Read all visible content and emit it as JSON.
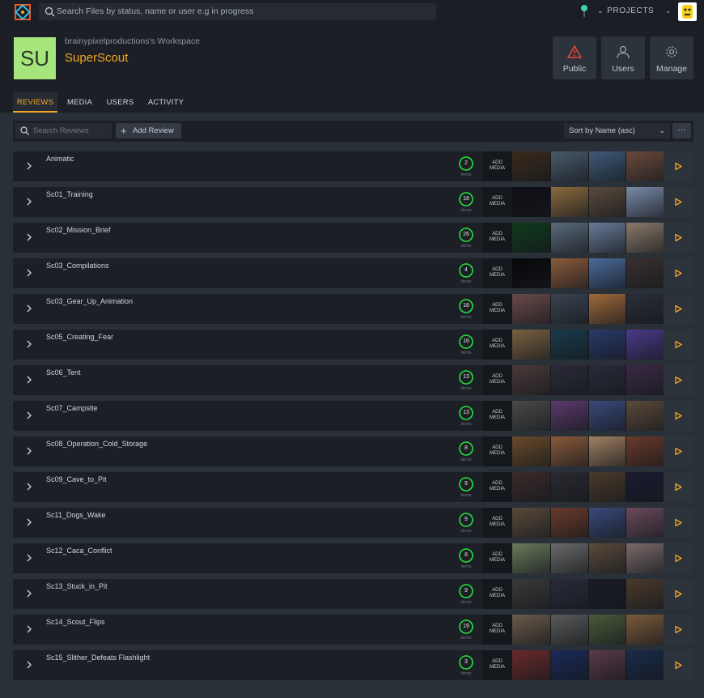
{
  "topbar": {
    "search_placeholder": "Search Files by status, name or user e.g in progress",
    "projects_label": "PROJECTS"
  },
  "workspace": {
    "initials": "SU",
    "workspace_name": "brainypixelproductions's Workspace",
    "project_name": "SuperScout",
    "actions": [
      {
        "label": "Public",
        "icon": "warning-icon"
      },
      {
        "label": "Users",
        "icon": "user-icon"
      },
      {
        "label": "Manage",
        "icon": "gear-icon"
      }
    ]
  },
  "tabs": [
    {
      "label": "REVIEWS",
      "active": true
    },
    {
      "label": "MEDIA",
      "active": false
    },
    {
      "label": "USERS",
      "active": false
    },
    {
      "label": "ACTIVITY",
      "active": false
    }
  ],
  "toolbar": {
    "search_placeholder": "Search Reviews",
    "add_review_label": "Add Review",
    "sort_label": "Sort by Name (asc)",
    "more_label": "···"
  },
  "row_labels": {
    "items_label": "items",
    "add_media_line1": "ADD",
    "add_media_line2": "MEDIA"
  },
  "colors": {
    "accent": "#f5a623",
    "ring_green": "#22e03a",
    "workspace_badge": "#a6e57c"
  },
  "reviews": [
    {
      "name": "Animatic",
      "count": "2",
      "thumbs": [
        "#3a2a1c",
        "#4a5a6a",
        "#3e5a78",
        "#6a4a3a"
      ]
    },
    {
      "name": "Sc01_Training",
      "count": "18",
      "thumbs": [
        "#0e0e14",
        "#8a6a3c",
        "#5a4a3c",
        "#7a8aa8"
      ]
    },
    {
      "name": "Sc02_Mission_Brief",
      "count": "26",
      "thumbs": [
        "#0e3a1c",
        "#5a6a7a",
        "#6a7a9a",
        "#8a7a6a"
      ]
    },
    {
      "name": "Sc03_Compilations",
      "count": "4",
      "thumbs": [
        "#08080a",
        "#8a5a3a",
        "#4a6a9a",
        "#3a3030"
      ]
    },
    {
      "name": "Sc03_Gear_Up_Animation",
      "count": "18",
      "thumbs": [
        "#6a4a4a",
        "#3a4450",
        "#a06a3a",
        "#2a2e36"
      ]
    },
    {
      "name": "Sc05_Creating_Fear",
      "count": "16",
      "thumbs": [
        "#7a6040",
        "#1a3a4a",
        "#2a3a6a",
        "#4a3a8a"
      ]
    },
    {
      "name": "Sc06_Tent",
      "count": "13",
      "thumbs": [
        "#4a3a3a",
        "#2a2a38",
        "#2a2a3a",
        "#3a2a44"
      ]
    },
    {
      "name": "Sc07_Campsite",
      "count": "13",
      "thumbs": [
        "#4a4a4a",
        "#5a3a6a",
        "#3a4a7a",
        "#5a4a3a"
      ]
    },
    {
      "name": "Sc08_Operation_Cold_Storage",
      "count": "8",
      "thumbs": [
        "#6a4a2a",
        "#8a5a3a",
        "#a08060",
        "#6a3a2a"
      ]
    },
    {
      "name": "Sc09_Cave_to_Pit",
      "count": "9",
      "thumbs": [
        "#3a2a2a",
        "#2a2a30",
        "#4a3a2a",
        "#1a1a30"
      ]
    },
    {
      "name": "Sc11_Dogs_Wake",
      "count": "9",
      "thumbs": [
        "#5a4a3a",
        "#6a3a2a",
        "#3a4a7a",
        "#6a4a5a"
      ]
    },
    {
      "name": "Sc12_Caca_Conflict",
      "count": "8",
      "thumbs": [
        "#6a7a5a",
        "#6a6a6a",
        "#5a4a3a",
        "#7a6a6a"
      ]
    },
    {
      "name": "Sc13_Stuck_in_Pit",
      "count": "9",
      "thumbs": [
        "#3a3a3a",
        "#2a2a3a",
        "#1a1a26",
        "#4a3a2a"
      ]
    },
    {
      "name": "Sc14_Scout_Flips",
      "count": "19",
      "thumbs": [
        "#6a5a4a",
        "#5a5a5a",
        "#4a5a3a",
        "#7a5a3a"
      ]
    },
    {
      "name": "Sc15_Slither_Defeats Flashlight",
      "count": "3",
      "thumbs": [
        "#6a2a2a",
        "#1a2a5a",
        "#5a3a4a",
        "#1a2a4a"
      ]
    }
  ]
}
